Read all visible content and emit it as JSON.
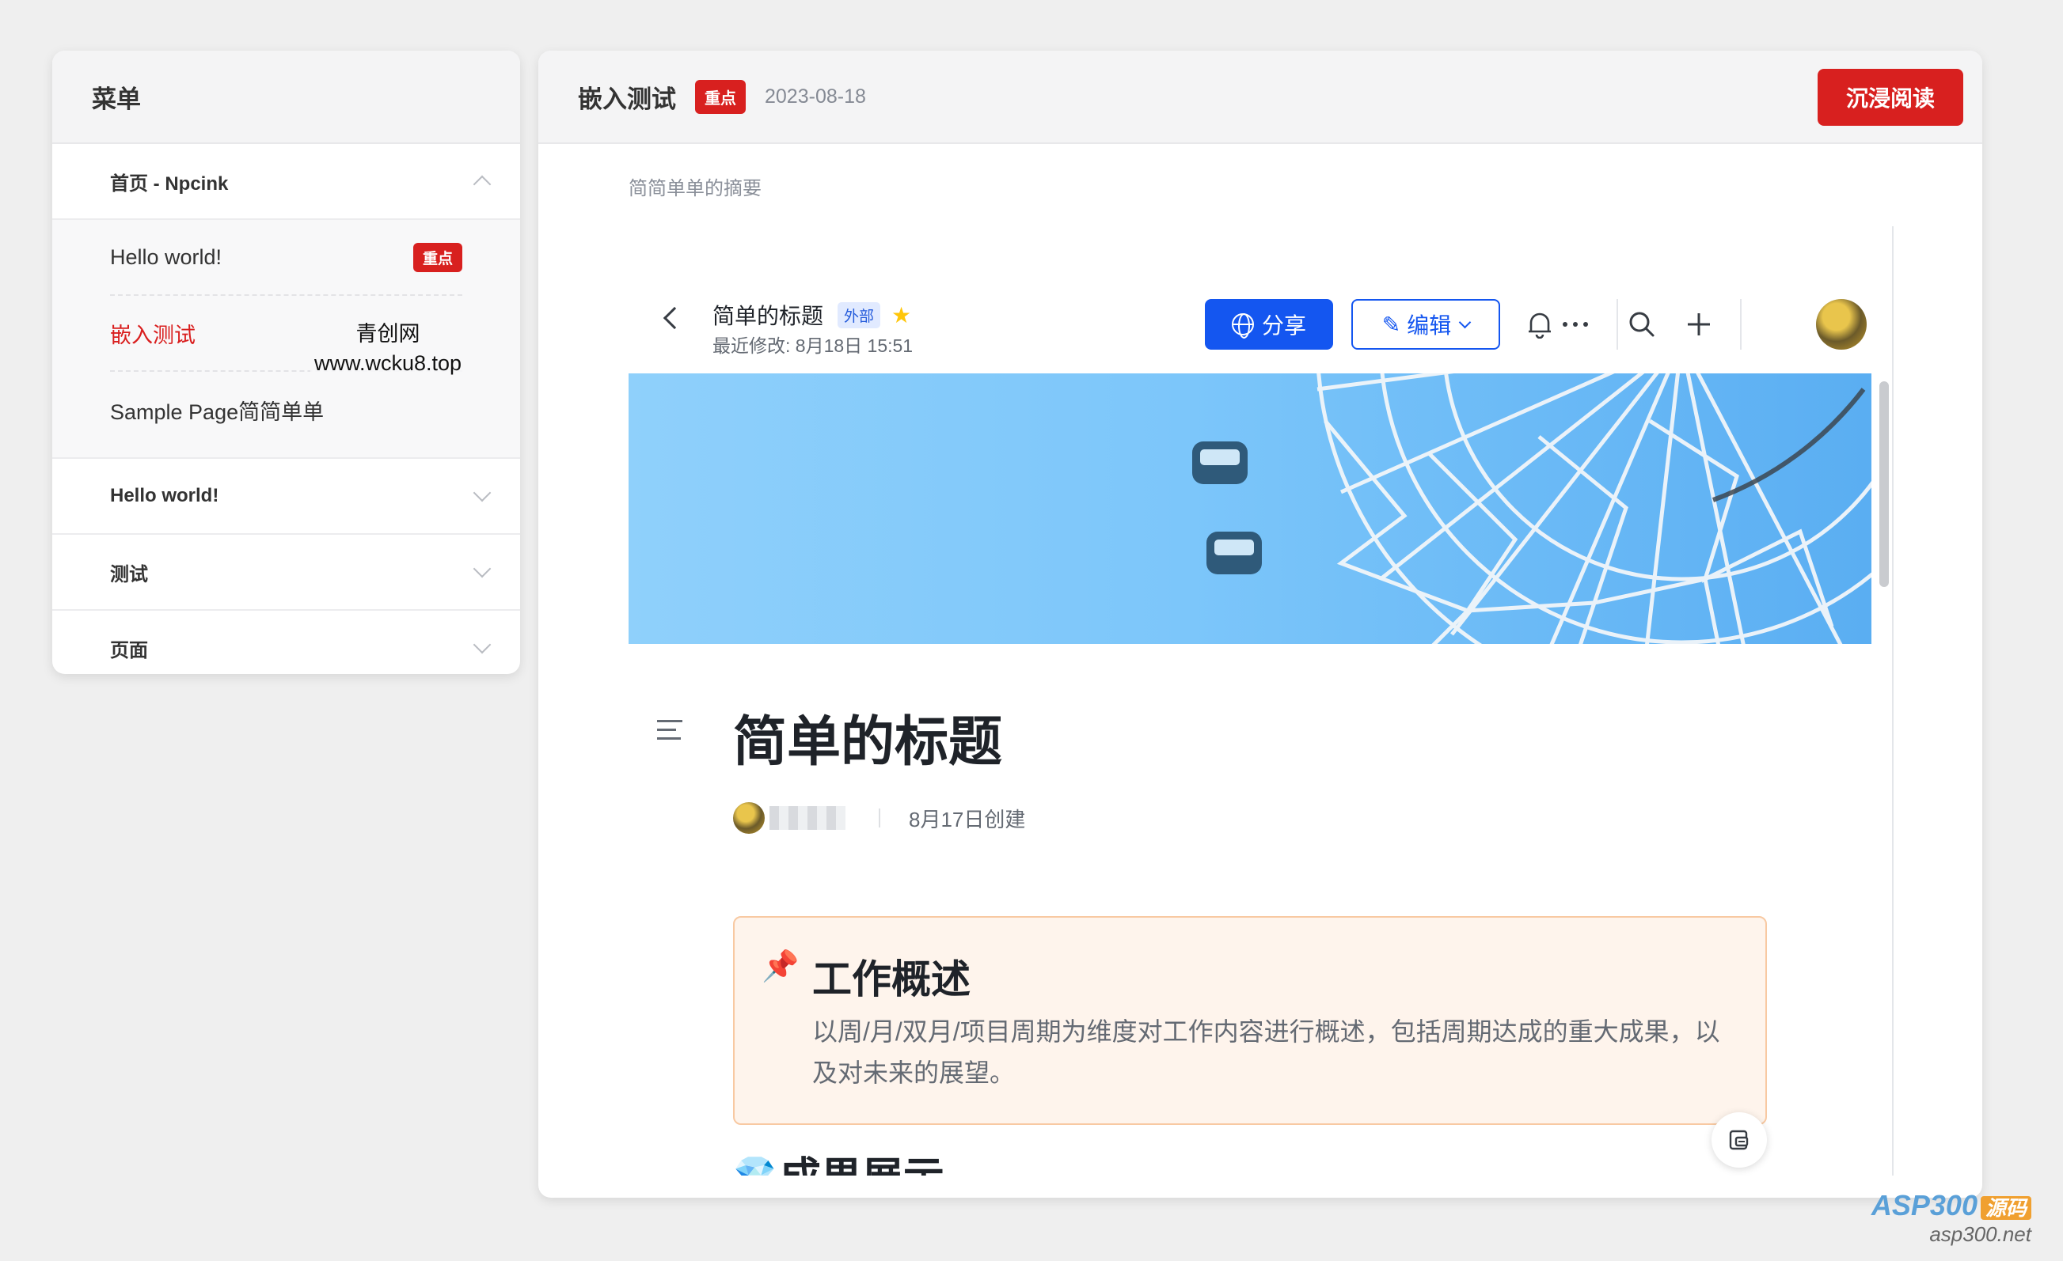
{
  "menu": {
    "title": "菜单",
    "groups": [
      {
        "label": "首页 - Npcink",
        "expanded": true,
        "items": [
          {
            "label": "Hello world!",
            "badge": "重点"
          },
          {
            "label": "嵌入测试",
            "active": true
          },
          {
            "label": "Sample Page简简单单"
          }
        ]
      },
      {
        "label": "Hello world!",
        "expanded": false
      },
      {
        "label": "测试",
        "expanded": false
      },
      {
        "label": "页面",
        "expanded": false
      }
    ],
    "watermark": {
      "line1": "青创网",
      "line2": "www.wcku8.top"
    }
  },
  "main": {
    "title": "嵌入测试",
    "badge": "重点",
    "date": "2023-08-18",
    "immersive_label": "沉浸阅读",
    "summary": "简简单单的摘要"
  },
  "doc": {
    "name": "简单的标题",
    "external_tag": "外部",
    "modified": "最近修改: 8月18日 15:51",
    "share_label": "分享",
    "edit_label": "编辑",
    "heading": "简单的标题",
    "created": "8月17日创建",
    "callout": {
      "title": "工作概述",
      "body": "以周/月/双月/项目周期为维度对工作内容进行概述，包括周期达成的重大成果，以及对未来的展望。"
    },
    "section_heading": "成果展示"
  },
  "site_logo": {
    "brand": "ASP300",
    "tag": "源码",
    "url": "asp300.net"
  },
  "colors": {
    "accent_red": "#d8201f",
    "accent_blue": "#1456f0",
    "callout_bg": "#fef4ec"
  }
}
